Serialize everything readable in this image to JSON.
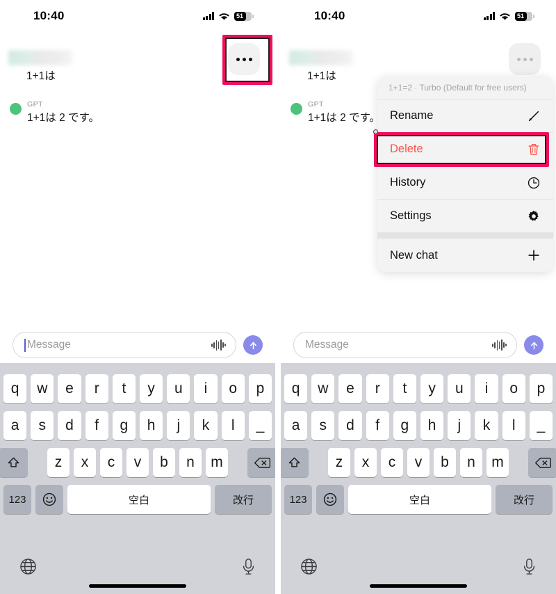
{
  "status": {
    "time": "10:40",
    "battery_level": "51",
    "signal_icon": "cellular-signal-icon",
    "wifi_icon": "wifi-icon",
    "battery_icon": "battery-icon"
  },
  "chat": {
    "user_message": "1+1は",
    "assistant_name": "GPT",
    "assistant_message": "1+1は 2 です。",
    "redacted_label": ""
  },
  "header": {
    "more_button_label": "",
    "more_icon": "more-horizontal-icon"
  },
  "menu": {
    "header_text": "1+1=2 · Turbo (Default for free users)",
    "items": [
      {
        "label": "Rename",
        "icon": "pencil-icon",
        "danger": false
      },
      {
        "label": "Delete",
        "icon": "trash-icon",
        "danger": true
      },
      {
        "label": "History",
        "icon": "clock-icon",
        "danger": false
      },
      {
        "label": "Settings",
        "icon": "gear-icon",
        "danger": false
      },
      {
        "label": "New chat",
        "icon": "plus-icon",
        "danger": false
      }
    ]
  },
  "composer": {
    "placeholder": "Message",
    "value": "",
    "voice_icon": "waveform-icon",
    "send_icon": "arrow-up-icon"
  },
  "keyboard": {
    "row1": [
      "q",
      "w",
      "e",
      "r",
      "t",
      "y",
      "u",
      "i",
      "o",
      "p"
    ],
    "row2": [
      "a",
      "s",
      "d",
      "f",
      "g",
      "h",
      "j",
      "k",
      "l",
      "_"
    ],
    "row3": [
      "z",
      "x",
      "c",
      "v",
      "b",
      "n",
      "m"
    ],
    "shift_icon": "shift-arrow-icon",
    "backspace_icon": "backspace-icon",
    "numbers_label": "123",
    "emoji_icon": "smiley-icon",
    "space_label": "空白",
    "return_label": "改行",
    "globe_icon": "globe-icon",
    "dictation_icon": "microphone-icon"
  },
  "annotations": {
    "highlight_color": "#ee0f5e",
    "highlight_inner_color": "#231f20",
    "delete_text_color": "#f9544a",
    "send_button_color": "#8a8aeb",
    "assistant_dot_color": "#4cc47c"
  }
}
